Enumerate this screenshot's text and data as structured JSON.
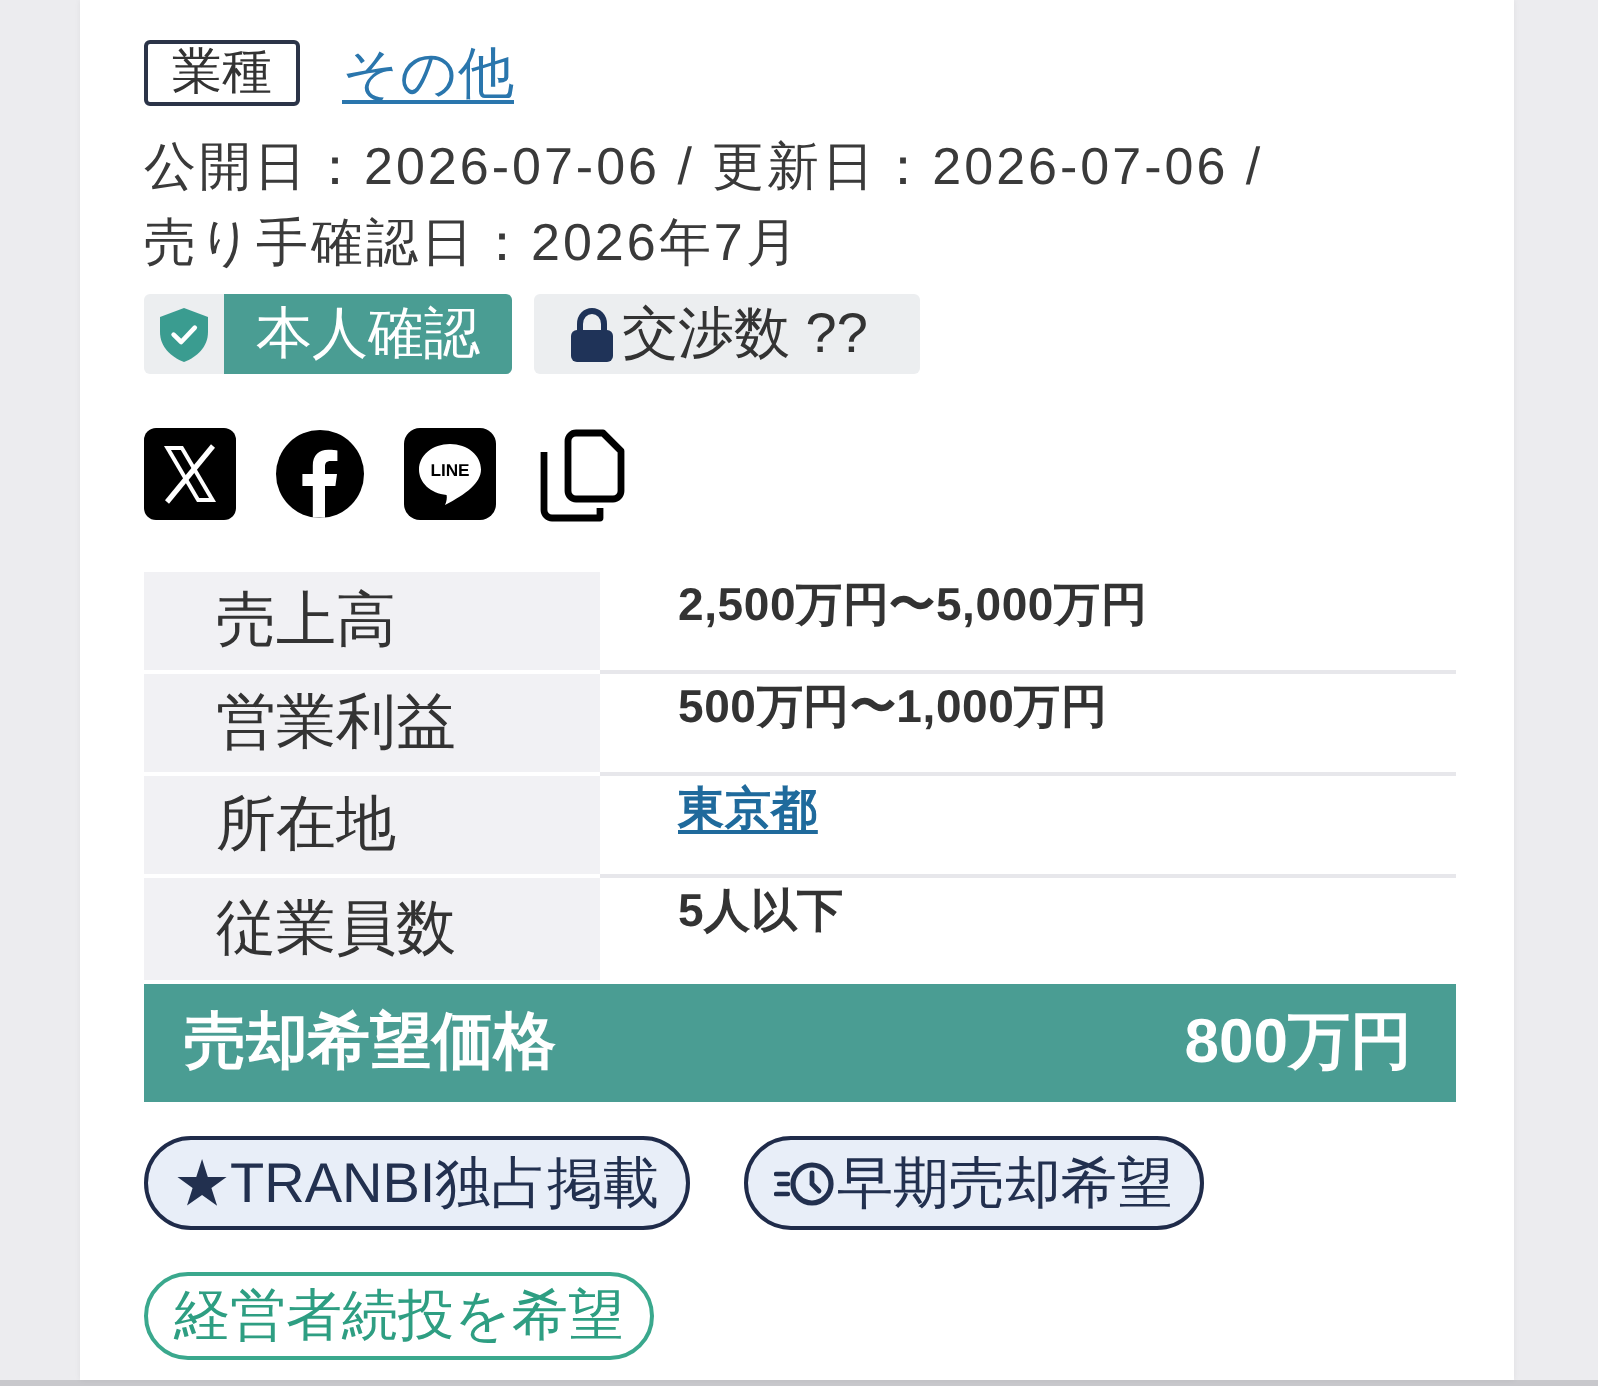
{
  "industry": {
    "label": "業種",
    "value": "その他"
  },
  "dates": "公開日：2026-07-06 / 更新日：2026-07-06 / 売り手確認日：2026年7月",
  "badges": [
    {
      "kind": "verified",
      "label": "本人確認"
    },
    {
      "kind": "locked",
      "label": "交渉数 ??"
    }
  ],
  "share": [
    {
      "kind": "x"
    },
    {
      "kind": "facebook"
    },
    {
      "kind": "line",
      "label": "LINE"
    },
    {
      "kind": "copy"
    }
  ],
  "table": [
    {
      "kind": "text",
      "label": "売上高",
      "value": "2,500万円〜5,000万円"
    },
    {
      "kind": "text",
      "label": "営業利益",
      "value": "500万円〜1,000万円"
    },
    {
      "kind": "link",
      "label": "所在地",
      "value": "東京都"
    },
    {
      "kind": "text",
      "label": "従業員数",
      "value": "5人以下"
    }
  ],
  "price": {
    "label": "売却希望価格",
    "value": "800万円"
  },
  "tags": [
    {
      "kind": "exclusive",
      "label": "★TRANBI独占掲載"
    },
    {
      "kind": "early",
      "label": "早期売却希望"
    },
    {
      "kind": "wish",
      "label": "経営者続投を希望"
    }
  ]
}
